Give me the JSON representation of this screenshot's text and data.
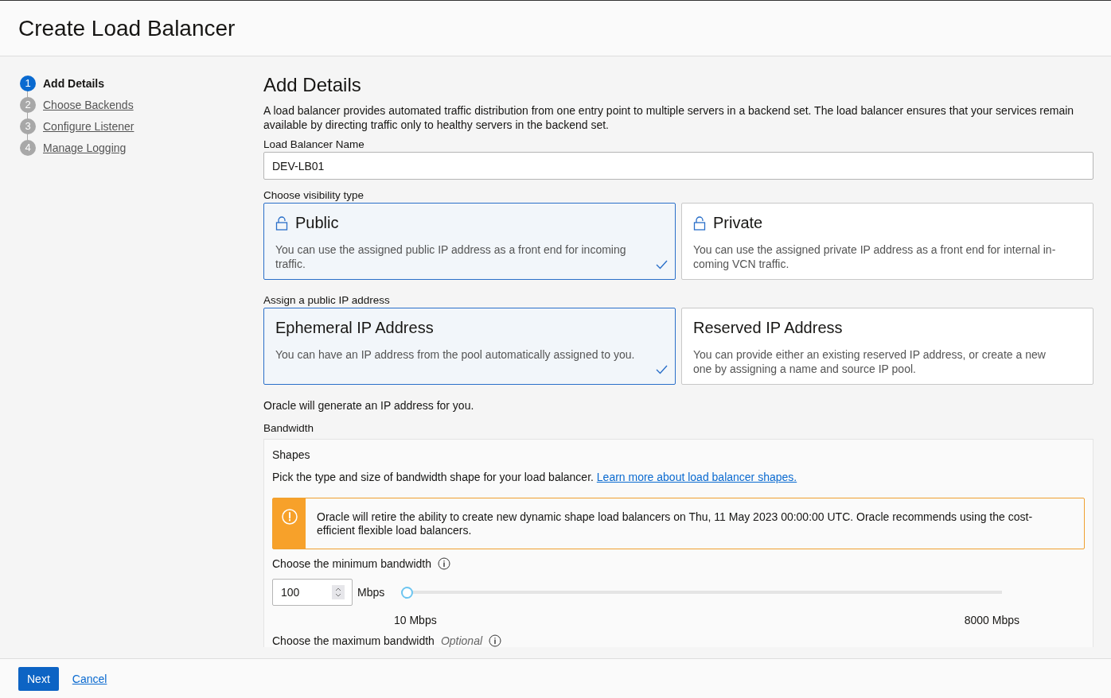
{
  "page": {
    "title": "Create Load Balancer"
  },
  "steps": [
    {
      "number": "1",
      "label": "Add Details",
      "selected": true
    },
    {
      "number": "2",
      "label": "Choose Backends",
      "selected": false
    },
    {
      "number": "3",
      "label": "Configure Listener",
      "selected": false
    },
    {
      "number": "4",
      "label": "Manage Logging",
      "selected": false
    }
  ],
  "section": {
    "heading": "Add Details",
    "description": "A load balancer provides automated traffic distribution from one entry point to multiple servers in a backend set. The load balancer ensures that your services remain available by directing traffic only to healthy servers in the backend set."
  },
  "name_field": {
    "label": "Load Balancer Name",
    "value": "DEV-LB01"
  },
  "visibility": {
    "label": "Choose visibility type",
    "options": [
      {
        "kind": "lock",
        "title": "Public",
        "description": "You can use the assigned public IP address as a front end for incoming traffic.",
        "selected": true
      },
      {
        "kind": "lock",
        "title": "Private",
        "description": "You can use the assigned private IP address as a front end for internal in-coming VCN traffic.",
        "selected": false
      }
    ]
  },
  "ip_assignment": {
    "label": "Assign a public IP address",
    "options": [
      {
        "title": "Ephemeral IP Address",
        "description": "You can have an IP address from the pool automatically assigned to you.",
        "selected": true
      },
      {
        "title": "Reserved IP Address",
        "description": "You can provide either an existing reserved IP address, or create a new one by assigning a name and source IP pool.",
        "selected": false
      }
    ]
  },
  "ip_note": "Oracle will generate an IP address for you.",
  "bandwidth": {
    "label": "Bandwidth",
    "shapes_label": "Shapes",
    "shapes_text": "Pick the type and size of bandwidth shape for your load balancer.",
    "shapes_link": "Learn more about load balancer shapes.",
    "warning": "Oracle will retire the ability to create new dynamic shape load balancers on Thu, 11 May 2023 00:00:00 UTC. Oracle recommends using the cost-efficient flexible load balancers.",
    "minimum": {
      "label": "Choose the minimum bandwidth",
      "value": "100",
      "unit": "Mbps",
      "level": 0.0,
      "min_label": "10 Mbps",
      "max_label": "8000 Mbps"
    },
    "maximum": {
      "label": "Choose the maximum bandwidth",
      "optional": "Optional"
    }
  },
  "footer": {
    "buttons": [
      {
        "kind": "primary",
        "label": "Next"
      },
      {
        "kind": "link",
        "label": "Cancel"
      }
    ]
  }
}
